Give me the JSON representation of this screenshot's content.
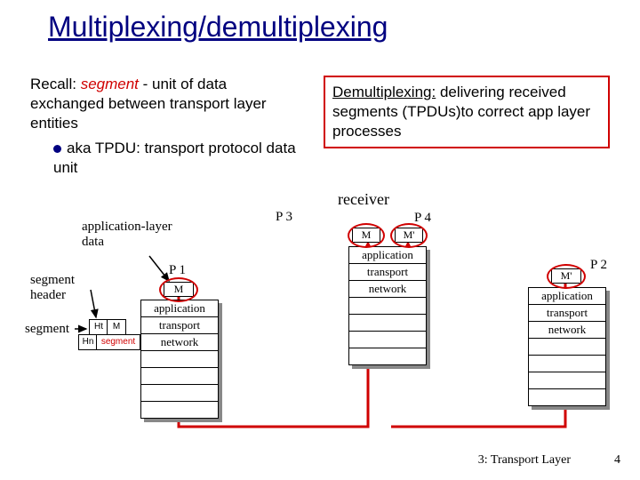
{
  "title": "Multiplexing/demultiplexing",
  "recall": {
    "prefix": "Recall: ",
    "term": "segment",
    "rest": " - unit of data exchanged between transport layer entities",
    "sub": "aka TPDU: transport protocol data unit"
  },
  "demux": {
    "term": "Demultiplexing:",
    "rest": " delivering received segments (TPDUs)to correct app layer processes"
  },
  "labels": {
    "appdata": "application-layer data",
    "segheader": "segment header",
    "segment": "segment",
    "receiver": "receiver",
    "P1": "P 1",
    "P2": "P 2",
    "P3": "P 3",
    "P4": "P 4",
    "M": "M",
    "M2": "M'",
    "Ht": "Ht",
    "Hn": "Hn",
    "segword": "segment"
  },
  "stack": {
    "application": "application",
    "transport": "transport",
    "network": "network"
  },
  "footer": {
    "chapter": "3: Transport Layer",
    "page": "4"
  }
}
